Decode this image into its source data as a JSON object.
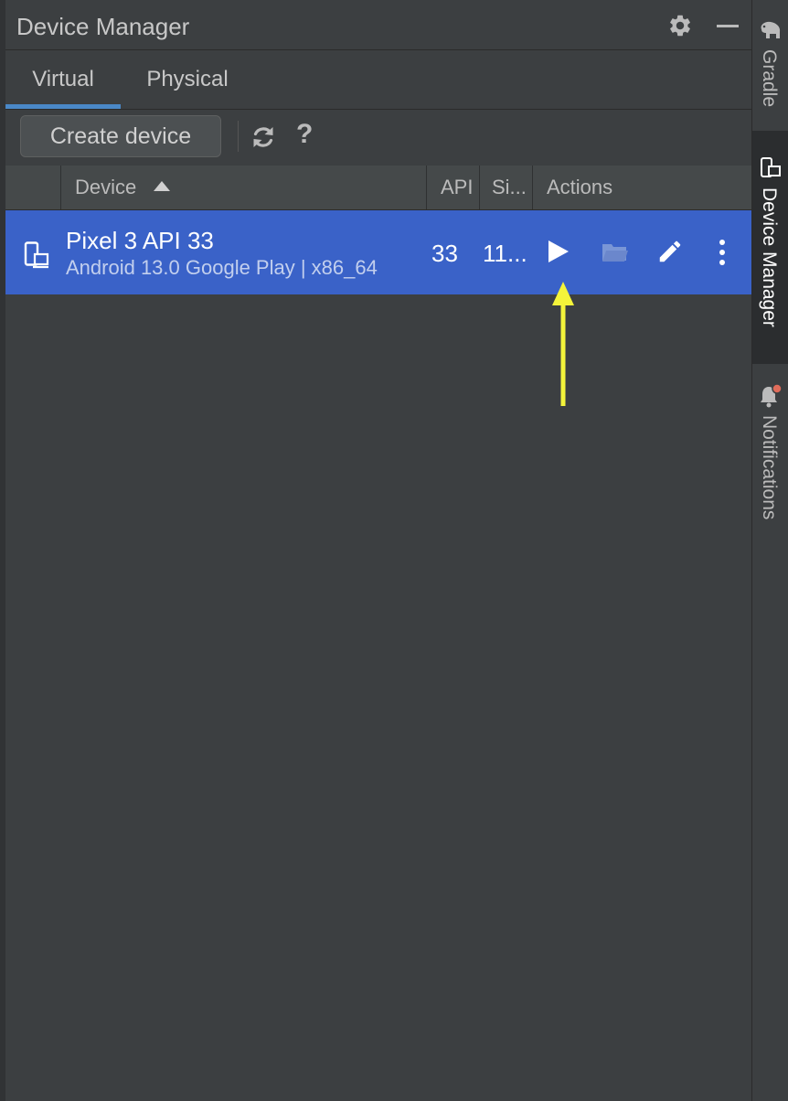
{
  "window": {
    "title": "Device Manager"
  },
  "tabs": [
    {
      "label": "Virtual",
      "active": true
    },
    {
      "label": "Physical",
      "active": false
    }
  ],
  "toolbar": {
    "create_label": "Create device",
    "help_label": "?"
  },
  "table": {
    "columns": [
      "Device",
      "API",
      "Si...",
      "Actions"
    ],
    "rows": [
      {
        "name": "Pixel 3 API 33",
        "subtitle": "Android 13.0 Google Play | x86_64",
        "api": "33",
        "size": "11..."
      }
    ]
  },
  "right_sidebar": {
    "tools": [
      {
        "label": "Gradle",
        "icon": "elephant-icon"
      },
      {
        "label": "Device Manager",
        "icon": "device-manager-icon",
        "active": true
      },
      {
        "label": "Notifications",
        "icon": "bell-icon"
      }
    ]
  },
  "colors": {
    "background": "#3c3f41",
    "selection": "#3a62c8",
    "tab_underline": "#4a88c7",
    "annotation_arrow": "#f4f43a",
    "notification_badge": "#e06c5a"
  },
  "icons": [
    "gear-icon",
    "minimize-icon",
    "refresh-icon",
    "help-icon",
    "sort-ascending-icon",
    "device-icon",
    "play-icon",
    "folder-icon",
    "pencil-icon",
    "more-vert-icon"
  ]
}
